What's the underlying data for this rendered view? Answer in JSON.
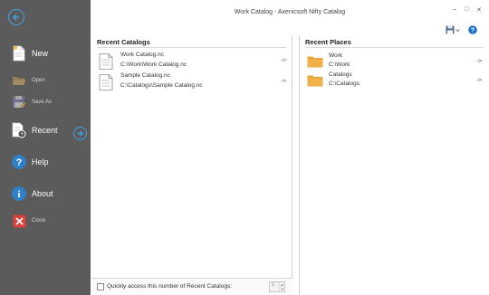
{
  "window": {
    "title": "Work Catalog - Axenicsoft Nifty Catalog",
    "controls": {
      "minimize": "–",
      "maximize": "□",
      "close": "✕"
    }
  },
  "sidebar": {
    "items": [
      {
        "label": "New",
        "icon": "new-document-icon",
        "size": "big"
      },
      {
        "label": "Open",
        "icon": "open-folder-icon",
        "size": "small"
      },
      {
        "label": "Save As",
        "icon": "save-as-icon",
        "size": "small"
      },
      {
        "label": "Recent",
        "icon": "recent-icon",
        "size": "big"
      },
      {
        "label": "Help",
        "icon": "help-icon",
        "size": "big"
      },
      {
        "label": "About",
        "icon": "info-icon",
        "size": "big"
      },
      {
        "label": "Close",
        "icon": "close-icon",
        "size": "small"
      }
    ]
  },
  "recent_catalogs": {
    "heading": "Recent Catalogs",
    "items": [
      {
        "name": "Work Catalog.nc",
        "path": "C:\\Work\\Work Catalog.nc",
        "pin": "-⊳"
      },
      {
        "name": "Sample Catalog.nc",
        "path": "C:\\Catalogs\\Sample Catalog.nc",
        "pin": "-⊳"
      }
    ]
  },
  "recent_places": {
    "heading": "Recent Places",
    "items": [
      {
        "name": "Work",
        "path": "C:\\Work",
        "pin": "-⊳"
      },
      {
        "name": "Catalogs",
        "path": "C:\\Catalogs",
        "pin": "-⊳"
      }
    ]
  },
  "bottom": {
    "checkbox_label": "Quickly access this number of Recent Catalogs:",
    "spinner_value": "1"
  },
  "colors": {
    "sidebar_bg": "#5b5b5b",
    "accent": "#3fa0e6",
    "folder": "#f0b04a"
  }
}
